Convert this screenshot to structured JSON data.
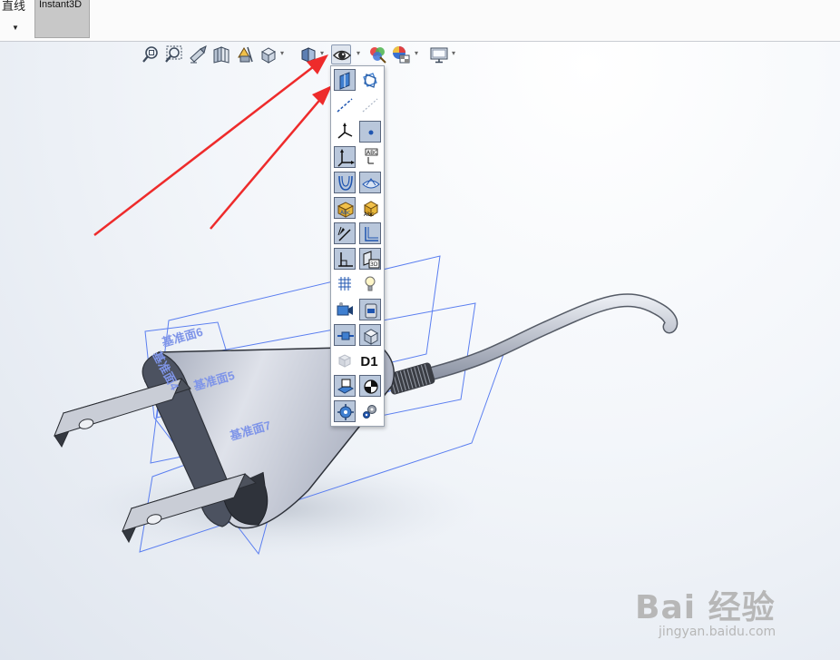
{
  "ribbon": {
    "cut_label": "直线",
    "instant3d_label": "Instant3D"
  },
  "toolbar": {
    "items": [
      {
        "icon": "zoom-to-fit-icon"
      },
      {
        "icon": "zoom-to-area-icon"
      },
      {
        "icon": "previous-view-icon"
      },
      {
        "icon": "section-view-icon"
      },
      {
        "icon": "dynamic-annotation-views-icon"
      },
      {
        "icon": "view-orientation-icon"
      },
      {
        "icon": "display-style-icon"
      },
      {
        "icon": "hide-show-items-icon"
      },
      {
        "icon": "edit-appearance-icon"
      },
      {
        "icon": "apply-scene-icon"
      },
      {
        "icon": "view-settings-icon"
      }
    ]
  },
  "flyout": {
    "d1_label": "D1",
    "buttons": [
      {
        "icon": "view-planes-icon",
        "active": true
      },
      {
        "icon": "view-all-planes-icon",
        "active": false
      },
      {
        "icon": "view-axes-icon",
        "active": false
      },
      {
        "icon": "view-temporary-axes-icon",
        "active": false
      },
      {
        "icon": "view-origins-icon",
        "active": false
      },
      {
        "icon": "view-points-icon",
        "active": true
      },
      {
        "icon": "view-coordinate-systems-icon",
        "active": true
      },
      {
        "icon": "view-named-coordinate-icon",
        "active": false
      },
      {
        "icon": "view-curves-icon",
        "active": true
      },
      {
        "icon": "view-surfaces-icon",
        "active": true
      },
      {
        "icon": "view-annotations-icon",
        "active": true
      },
      {
        "icon": "view-part-annotations-icon",
        "active": false
      },
      {
        "icon": "view-sketch-dimensions-icon",
        "active": true
      },
      {
        "icon": "view-sketches-icon",
        "active": true
      },
      {
        "icon": "view-sketch-relations-icon",
        "active": true
      },
      {
        "icon": "view-3d-sketch-planes-icon",
        "active": true
      },
      {
        "icon": "view-grid-icon",
        "active": false
      },
      {
        "icon": "view-lights-icon",
        "active": false
      },
      {
        "icon": "view-cameras-icon",
        "active": false
      },
      {
        "icon": "view-decals-icon",
        "active": true
      },
      {
        "icon": "view-mates-icon",
        "active": true
      },
      {
        "icon": "view-bodies-icon",
        "active": true
      },
      {
        "icon": "view-routing-points-icon",
        "active": false
      },
      {
        "icon": "view-dimension-names-icon",
        "active": false
      },
      {
        "icon": "view-sketch-planes-icon",
        "active": true
      },
      {
        "icon": "view-center-of-mass-icon",
        "active": true
      },
      {
        "icon": "view-weld-beads-icon",
        "active": true
      },
      {
        "icon": "view-settings-gear-icon",
        "active": false
      }
    ]
  },
  "scene": {
    "plane_labels": [
      "基准面6",
      "基准面4",
      "基准面5",
      "基准面7"
    ]
  },
  "watermark": {
    "logo_text": "Bai 经验",
    "url_text": "jingyan.baidu.com"
  },
  "colors": {
    "plane_outline": "#5a7ef0",
    "annotation_arrow": "#ee2b2b",
    "part_body": "#c7cbd6",
    "active_button": "#b9c7db"
  }
}
